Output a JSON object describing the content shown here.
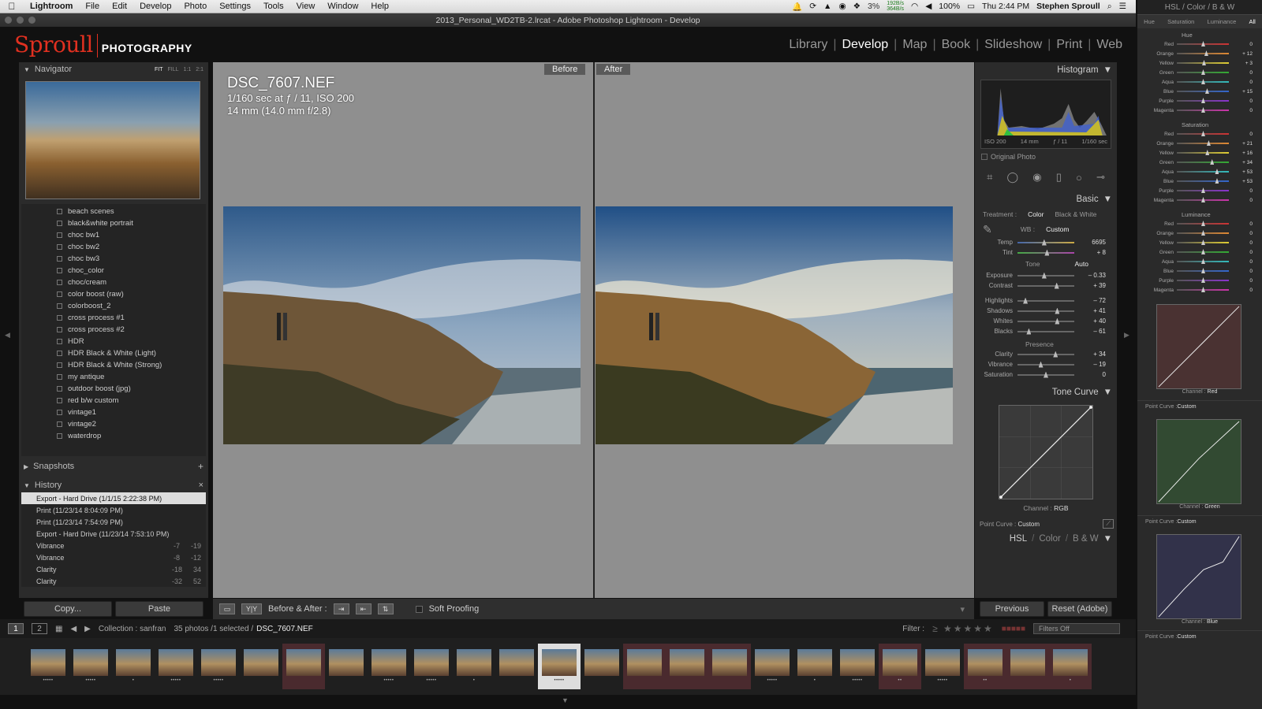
{
  "menubar": {
    "app": "Lightroom",
    "items": [
      "File",
      "Edit",
      "Develop",
      "Photo",
      "Settings",
      "Tools",
      "View",
      "Window",
      "Help"
    ],
    "cpu": "3%",
    "net_tx": "192B/s",
    "net_rx": "364B/s",
    "battery": "100%",
    "clock": "Thu 2:44 PM",
    "user": "Stephen Sproull"
  },
  "window": {
    "title": "2013_Personal_WD2TB-2.lrcat - Adobe Photoshop Lightroom - Develop"
  },
  "identity": {
    "logo_main": "Sproull",
    "logo_sub": "PHOTOGRAPHY"
  },
  "modules": [
    "Library",
    "Develop",
    "Map",
    "Book",
    "Slideshow",
    "Print",
    "Web"
  ],
  "active_module": "Develop",
  "navigator": {
    "title": "Navigator",
    "opts": [
      "FIT",
      "FILL",
      "1:1",
      "2:1"
    ]
  },
  "presets": [
    "beach scenes",
    "black&white portrait",
    "choc bw1",
    "choc bw2",
    "choc bw3",
    "choc_color",
    "choc/cream",
    "color boost (raw)",
    "colorboost_2",
    "cross process #1",
    "cross process #2",
    "HDR",
    "HDR Black & White (Light)",
    "HDR Black & White (Strong)",
    "my antique",
    "outdoor boost (jpg)",
    "red b/w custom",
    "vintage1",
    "vintage2",
    "waterdrop"
  ],
  "snapshots": {
    "title": "Snapshots"
  },
  "history": {
    "title": "History",
    "items": [
      {
        "label": "Export - Hard Drive (1/1/15 2:22:38 PM)",
        "a": "",
        "b": ""
      },
      {
        "label": "Print (11/23/14 8:04:09 PM)",
        "a": "",
        "b": ""
      },
      {
        "label": "Print (11/23/14 7:54:09 PM)",
        "a": "",
        "b": ""
      },
      {
        "label": "Export - Hard Drive (11/23/14 7:53:10 PM)",
        "a": "",
        "b": ""
      },
      {
        "label": "Vibrance",
        "a": "-7",
        "b": "-19"
      },
      {
        "label": "Vibrance",
        "a": "-8",
        "b": "-12"
      },
      {
        "label": "Clarity",
        "a": "-18",
        "b": "34"
      },
      {
        "label": "Clarity",
        "a": "-32",
        "b": "52"
      }
    ]
  },
  "leftbuttons": {
    "copy": "Copy...",
    "paste": "Paste"
  },
  "center": {
    "before": "Before",
    "after": "After",
    "filename": "DSC_7607.NEF",
    "exposure": "1/160 sec at ƒ / 11, ISO 200",
    "lens": "14 mm (14.0 mm f/2.8)"
  },
  "toolbar": {
    "view_mode": "Y|Y",
    "before_after": "Before & After :",
    "soft_proofing": "Soft Proofing"
  },
  "histogram": {
    "title": "Histogram",
    "iso": "ISO 200",
    "focal": "14 mm",
    "aperture": "ƒ / 11",
    "shutter": "1/160 sec",
    "original": "Original Photo"
  },
  "basic": {
    "title": "Basic",
    "treatment_label": "Treatment :",
    "treat_color": "Color",
    "treat_bw": "Black & White",
    "wb_label": "WB :",
    "wb_value": "Custom",
    "tone_label": "Tone",
    "auto": "Auto",
    "presence_label": "Presence",
    "sliders": [
      {
        "label": "Temp",
        "value": "6695",
        "pos": 0.47,
        "grad": "linear-gradient(90deg,#46a,#ca4)"
      },
      {
        "label": "Tint",
        "value": "+ 8",
        "pos": 0.52,
        "grad": "linear-gradient(90deg,#4a4,#a4a)"
      }
    ],
    "tone": [
      {
        "label": "Exposure",
        "value": "– 0.33",
        "pos": 0.47
      },
      {
        "label": "Contrast",
        "value": "+ 39",
        "pos": 0.69
      }
    ],
    "tone2": [
      {
        "label": "Highlights",
        "value": "– 72",
        "pos": 0.14
      },
      {
        "label": "Shadows",
        "value": "+ 41",
        "pos": 0.7
      },
      {
        "label": "Whites",
        "value": "+ 40",
        "pos": 0.7
      },
      {
        "label": "Blacks",
        "value": "– 61",
        "pos": 0.2
      }
    ],
    "presence": [
      {
        "label": "Clarity",
        "value": "+ 34",
        "pos": 0.67
      },
      {
        "label": "Vibrance",
        "value": "– 19",
        "pos": 0.41
      },
      {
        "label": "Saturation",
        "value": "0",
        "pos": 0.5
      }
    ]
  },
  "tonecurve": {
    "title": "Tone Curve",
    "channel_label": "Channel :",
    "channel": "RGB",
    "pc_label": "Point Curve :",
    "pc_value": "Custom"
  },
  "hsltitle": {
    "hsl": "HSL",
    "color": "Color",
    "bw": "B & W"
  },
  "rightbuttons": {
    "previous": "Previous",
    "reset": "Reset (Adobe)"
  },
  "hslpanel": {
    "tabs": [
      "Hue",
      "Saturation",
      "Luminance",
      "All"
    ],
    "hue": {
      "title": "Hue",
      "rows": [
        {
          "l": "Red",
          "v": "0"
        },
        {
          "l": "Orange",
          "v": "+ 12"
        },
        {
          "l": "Yellow",
          "v": "+ 3"
        },
        {
          "l": "Green",
          "v": "0"
        },
        {
          "l": "Aqua",
          "v": "0"
        },
        {
          "l": "Blue",
          "v": "+ 15"
        },
        {
          "l": "Purple",
          "v": "0"
        },
        {
          "l": "Magenta",
          "v": "0"
        }
      ]
    },
    "sat": {
      "title": "Saturation",
      "rows": [
        {
          "l": "Red",
          "v": "0"
        },
        {
          "l": "Orange",
          "v": "+ 21"
        },
        {
          "l": "Yellow",
          "v": "+ 16"
        },
        {
          "l": "Green",
          "v": "+ 34"
        },
        {
          "l": "Aqua",
          "v": "+ 53"
        },
        {
          "l": "Blue",
          "v": "+ 53"
        },
        {
          "l": "Purple",
          "v": "0"
        },
        {
          "l": "Magenta",
          "v": "0"
        }
      ]
    },
    "lum": {
      "title": "Luminance",
      "rows": [
        {
          "l": "Red",
          "v": "0"
        },
        {
          "l": "Orange",
          "v": "0"
        },
        {
          "l": "Yellow",
          "v": "0"
        },
        {
          "l": "Green",
          "v": "0"
        },
        {
          "l": "Aqua",
          "v": "0"
        },
        {
          "l": "Blue",
          "v": "0"
        },
        {
          "l": "Purple",
          "v": "0"
        },
        {
          "l": "Magenta",
          "v": "0"
        }
      ]
    },
    "curves": [
      {
        "channel": "Red"
      },
      {
        "channel": "Green"
      },
      {
        "channel": "Blue"
      }
    ],
    "pc_label": "Point Curve :",
    "pc_value": "Custom",
    "channel_label": "Channel :"
  },
  "filterbar": {
    "pages": [
      "1",
      "2"
    ],
    "collection": "Collection : sanfran",
    "count": "35 photos /1 selected /",
    "selected": "DSC_7607.NEF",
    "filter": "Filter :",
    "filters_off": "Filters Off"
  },
  "filmstrip": {
    "selected_index": 12,
    "pink": [
      6,
      14,
      15,
      16,
      20,
      22,
      23,
      24
    ],
    "stars": [
      "•••••",
      "•••••",
      "•",
      "•••••",
      "•••••",
      "",
      "",
      "",
      "•••••",
      "•••••",
      "•",
      "",
      "•••••",
      "",
      "",
      "",
      "",
      "•••••",
      "•",
      "•••••",
      "••",
      "•••••",
      "••",
      "",
      "•"
    ]
  }
}
